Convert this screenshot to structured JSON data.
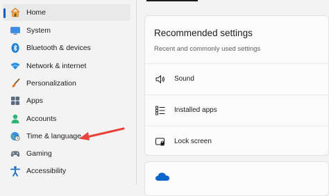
{
  "sidebar": {
    "items": [
      {
        "label": "Home",
        "icon": "home-icon",
        "selected": true
      },
      {
        "label": "System",
        "icon": "monitor-icon",
        "selected": false
      },
      {
        "label": "Bluetooth & devices",
        "icon": "bluetooth-icon",
        "selected": false
      },
      {
        "label": "Network & internet",
        "icon": "wifi-icon",
        "selected": false
      },
      {
        "label": "Personalization",
        "icon": "brush-icon",
        "selected": false
      },
      {
        "label": "Apps",
        "icon": "apps-icon",
        "selected": false
      },
      {
        "label": "Accounts",
        "icon": "person-icon",
        "selected": false
      },
      {
        "label": "Time & language",
        "icon": "globe-clock-icon",
        "selected": false
      },
      {
        "label": "Gaming",
        "icon": "gamepad-icon",
        "selected": false
      },
      {
        "label": "Accessibility",
        "icon": "accessibility-icon",
        "selected": false
      }
    ]
  },
  "main": {
    "recommended": {
      "title": "Recommended settings",
      "subtitle": "Recent and commonly used settings",
      "rows": [
        {
          "label": "Sound",
          "icon": "speaker-icon"
        },
        {
          "label": "Installed apps",
          "icon": "list-icon"
        },
        {
          "label": "Lock screen",
          "icon": "lock-screen-icon"
        }
      ]
    },
    "next_card": {
      "icon": "onedrive-cloud-icon"
    }
  },
  "annotation": {
    "arrow_color": "#e8433a",
    "points_to": "Time & language"
  },
  "colors": {
    "accent": "#005fb8",
    "selected_bg": "#e9e9e9",
    "card_bg": "#fbfbfb",
    "window_bg": "#f3f3f3"
  }
}
